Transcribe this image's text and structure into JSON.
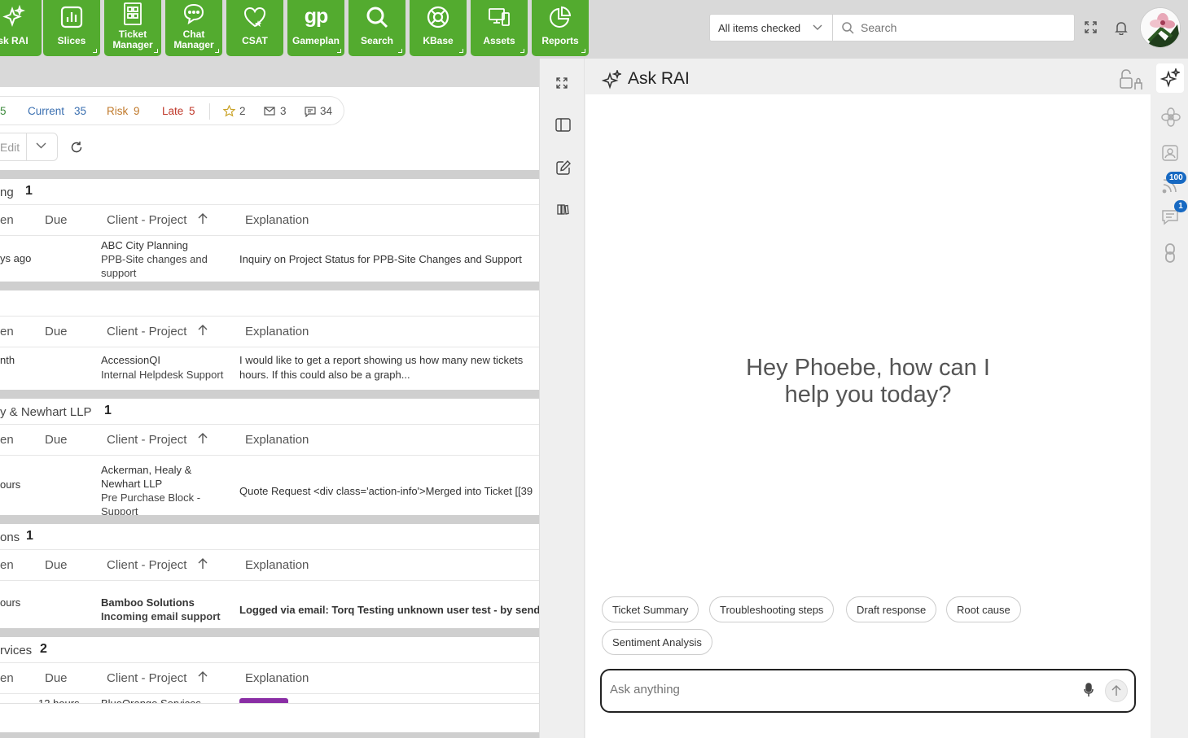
{
  "nav": {
    "items": [
      {
        "label": "Ask RAI",
        "icon": "sparkle-icon"
      },
      {
        "label": "Slices",
        "icon": "bar-chart-icon"
      },
      {
        "label1": "Ticket",
        "label2": "Manager",
        "icon": "ticket-icon"
      },
      {
        "label1": "Chat",
        "label2": "Manager",
        "icon": "chat-icon"
      },
      {
        "label": "CSAT",
        "icon": "heart-icon"
      },
      {
        "label": "Gameplan",
        "icon": "gameplan-icon"
      },
      {
        "label": "Search",
        "icon": "search-icon"
      },
      {
        "label": "KBase",
        "icon": "lifebuoy-icon"
      },
      {
        "label": "Assets",
        "icon": "devices-icon"
      },
      {
        "label": "Reports",
        "icon": "pie-chart-icon"
      }
    ],
    "ask_rai_visible": "sk RAI",
    "gameplan_logo": "gp"
  },
  "topbar": {
    "filter_value": "All items checked",
    "search_placeholder": "Search"
  },
  "tally": {
    "first": "5",
    "current_label": "Current",
    "current_count": "35",
    "risk_label": "Risk",
    "risk_count": "9",
    "late_label": "Late",
    "late_count": "5",
    "stars": "2",
    "mail": "3",
    "comments": "34"
  },
  "toolbar": {
    "edit_label": "Edit"
  },
  "columns": {
    "open": "en",
    "due": "Due",
    "client": "Client - Project",
    "explanation": "Explanation"
  },
  "groups": [
    {
      "name": "ng",
      "count": "1",
      "row": {
        "open": "ys ago",
        "due": "",
        "client": "ABC City Planning",
        "proj1": "PPB-Site changes and",
        "proj2": "support",
        "expl1": "Inquiry on Project Status for PPB-Site Changes and Support",
        "expl2": ""
      }
    },
    {
      "name": "",
      "count": "",
      "row": {
        "open": "nth",
        "due": "",
        "client": "AccessionQI",
        "proj1": "Internal Helpdesk Support",
        "proj2": "",
        "expl1": "I would like to get a report showing us how many new tickets",
        "expl2": "hours. If this could also be a graph..."
      }
    },
    {
      "name": "y & Newhart LLP",
      "count": "1",
      "row": {
        "open": "ours",
        "due": "",
        "client1": "Ackerman, Healy &",
        "client2": "Newhart LLP",
        "proj1": "Pre Purchase Block -",
        "proj2": "Support",
        "expl1": "Quote Request <div class='action-info'>Merged into Ticket [[39"
      }
    },
    {
      "name": "ons",
      "count": "1",
      "row": {
        "open": "ours",
        "due": "",
        "client": "Bamboo Solutions",
        "proj1": "Incoming email support",
        "expl1": "Logged via email: Torq Testing unknown user test - by sender"
      }
    },
    {
      "name": "rvices",
      "count": "2",
      "row": {
        "open": "",
        "due": "12 hours",
        "client": "BlueOrange Services"
      }
    }
  ],
  "rai": {
    "title": "Ask RAI",
    "greeting_line1": "Hey Phoebe, how can I",
    "greeting_line2": "help you today?",
    "chips": [
      "Ticket Summary",
      "Troubleshooting steps",
      "Draft response",
      "Root cause",
      "Sentiment Analysis"
    ],
    "input_placeholder": "Ask anything"
  },
  "rail": {
    "feed_badge": "100",
    "chat_badge": "1"
  },
  "colors": {
    "nav_green": "#53ab2f",
    "current": "#3a6fb0",
    "risk": "#c0792a",
    "late": "#c0392b",
    "badge": "#1769c2",
    "ok": "#3c8a3c"
  }
}
